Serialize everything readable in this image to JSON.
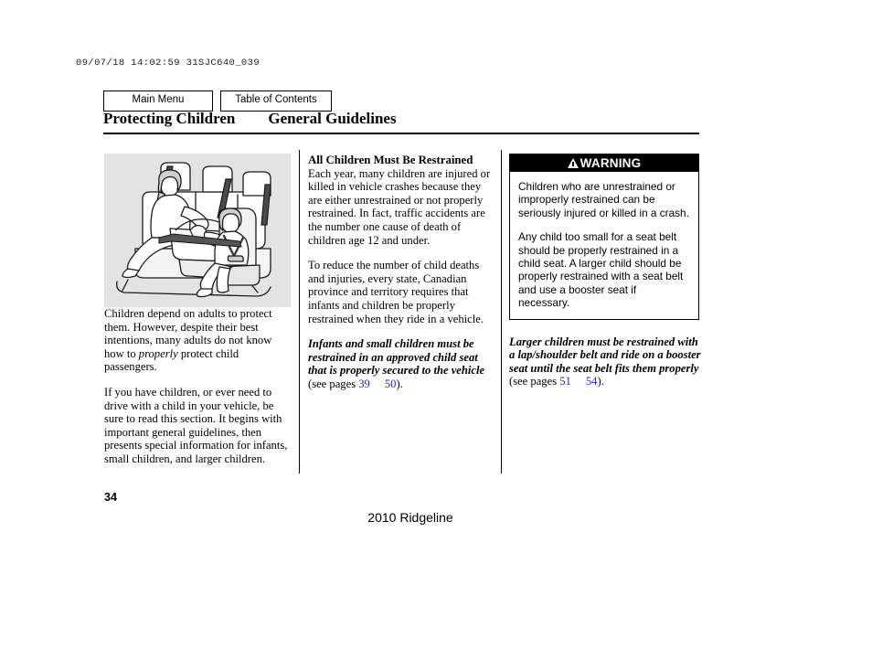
{
  "print_header": "09/07/18 14:02:59 31SJC640_039",
  "nav": {
    "main_menu": "Main Menu",
    "table_of_contents": "Table of Contents"
  },
  "title": {
    "main": "Protecting Children",
    "sub": "General Guidelines"
  },
  "left_column": {
    "figure_name": "rear-seat-child-restraint-illustration",
    "paragraphs": [
      "Children depend on adults to protect them. However, despite their best intentions, many adults do not know how to ",
      "If you have children, or ever need to drive with a child in your vehicle, be sure to read this section. It begins with important general guidelines, then presents special information for infants, small children, and larger children."
    ],
    "p1_italic": "properly",
    "p1_tail": " protect child passengers."
  },
  "middle_column": {
    "heading": "All Children Must Be Restrained",
    "paragraph1": "Each year, many children are injured or killed in vehicle crashes because they are either unrestrained or not properly restrained. In fact, traffic accidents are the number one cause of death of children age 12 and under.",
    "paragraph2": "To reduce the number of child deaths and injuries, every state, Canadian province and territory requires that infants and children be properly restrained when they ride in a vehicle.",
    "emphasis": "Infants and small children must be restrained in an approved child seat that is properly secured to the vehicle",
    "see_pages_prefix": " (see pages ",
    "page_link_1": "39",
    "page_link_2": "50",
    "see_pages_suffix": ")."
  },
  "right_column": {
    "warning_label": "WARNING",
    "warning_icon": "warning-triangle-icon",
    "warning_paragraph1": "Children who are unrestrained or improperly restrained can be seriously injured or killed in a crash.",
    "warning_paragraph2": "Any child too small for a seat belt should be properly restrained in a child seat. A larger child should be properly restrained with a seat belt and use a booster seat if necessary.",
    "note_emphasis": "Larger children must be restrained with a lap/shoulder belt and ride on a booster seat until the seat belt fits them properly",
    "see_pages_prefix": " (see pages ",
    "page_link_1": "51",
    "page_link_2": "54",
    "see_pages_suffix": ")."
  },
  "footer": {
    "page_number": "34",
    "model": "2010 Ridgeline"
  },
  "colors": {
    "link": "#2222dd",
    "warning_bar": "#000000",
    "figure_background": "#e3e3e3"
  }
}
